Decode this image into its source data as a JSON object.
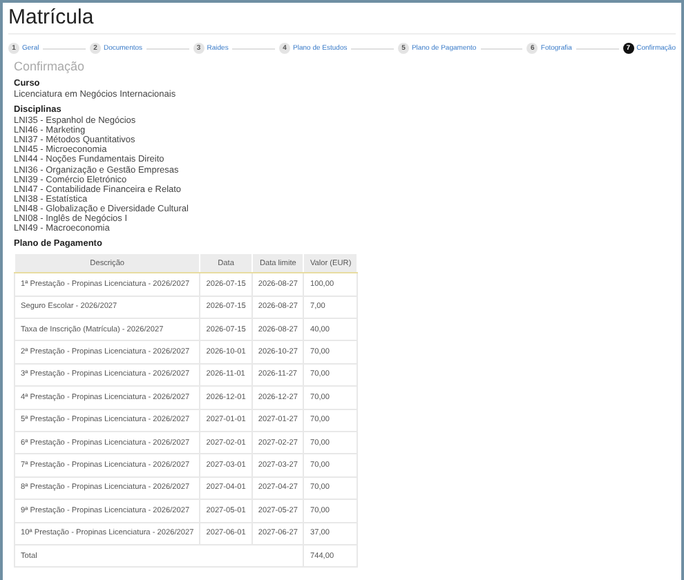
{
  "window": {
    "title": "Matrícula"
  },
  "steps": [
    {
      "number": "1",
      "label": "Geral",
      "selected": false
    },
    {
      "number": "2",
      "label": "Documentos",
      "selected": false
    },
    {
      "number": "3",
      "label": "Raides",
      "selected": false
    },
    {
      "number": "4",
      "label": "Plano de Estudos",
      "selected": false
    },
    {
      "number": "5",
      "label": "Plano de Pagamento",
      "selected": false
    },
    {
      "number": "6",
      "label": "Fotografia",
      "selected": false
    },
    {
      "number": "7",
      "label": "Confirmação",
      "selected": true
    }
  ],
  "section_title": "Confirmação",
  "course": {
    "heading": "Curso",
    "value": "Licenciatura em Negócios Internacionais"
  },
  "subjects": {
    "heading": "Disciplinas",
    "items": [
      "LNI35 - Espanhol de Negócios",
      "LNI46 - Marketing",
      "LNI37 - Métodos Quantitativos",
      "LNI45 - Microeconomia",
      "LNI44 - Noções Fundamentais Direito",
      "LNI36 - Organização e Gestão Empresas",
      "LNI39 - Comércio Eletrónico",
      "LNI47 - Contabilidade Financeira e Relato",
      "LNI38 - Estatística",
      "LNI48 - Globalização e Diversidade Cultural",
      "LNI08 - Inglês de Negócios I",
      "LNI49 - Macroeconomia"
    ]
  },
  "payment_plan": {
    "heading": "Plano de Pagamento",
    "columns": [
      "Descrição",
      "Data",
      "Data limite",
      "Valor (EUR)"
    ],
    "rows": [
      [
        "1ª Prestação - Propinas Licenciatura - 2026/2027",
        "2026-07-15",
        "2026-08-27",
        "100,00"
      ],
      [
        "Seguro Escolar - 2026/2027",
        "2026-07-15",
        "2026-08-27",
        "7,00"
      ],
      [
        "Taxa de Inscrição (Matrícula) - 2026/2027",
        "2026-07-15",
        "2026-08-27",
        "40,00"
      ],
      [
        "2ª Prestação - Propinas Licenciatura - 2026/2027",
        "2026-10-01",
        "2026-10-27",
        "70,00"
      ],
      [
        "3ª Prestação - Propinas Licenciatura - 2026/2027",
        "2026-11-01",
        "2026-11-27",
        "70,00"
      ],
      [
        "4ª Prestação - Propinas Licenciatura - 2026/2027",
        "2026-12-01",
        "2026-12-27",
        "70,00"
      ],
      [
        "5ª Prestação - Propinas Licenciatura - 2026/2027",
        "2027-01-01",
        "2027-01-27",
        "70,00"
      ],
      [
        "6ª Prestação - Propinas Licenciatura - 2026/2027",
        "2027-02-01",
        "2027-02-27",
        "70,00"
      ],
      [
        "7ª Prestação - Propinas Licenciatura - 2026/2027",
        "2027-03-01",
        "2027-03-27",
        "70,00"
      ],
      [
        "8ª Prestação - Propinas Licenciatura - 2026/2027",
        "2027-04-01",
        "2027-04-27",
        "70,00"
      ],
      [
        "9ª Prestação - Propinas Licenciatura - 2026/2027",
        "2027-05-01",
        "2027-05-27",
        "70,00"
      ],
      [
        "10ª Prestação - Propinas Licenciatura - 2026/2027",
        "2027-06-01",
        "2027-06-27",
        "37,00"
      ]
    ],
    "total": {
      "label": "Total",
      "value": "744,00"
    }
  }
}
